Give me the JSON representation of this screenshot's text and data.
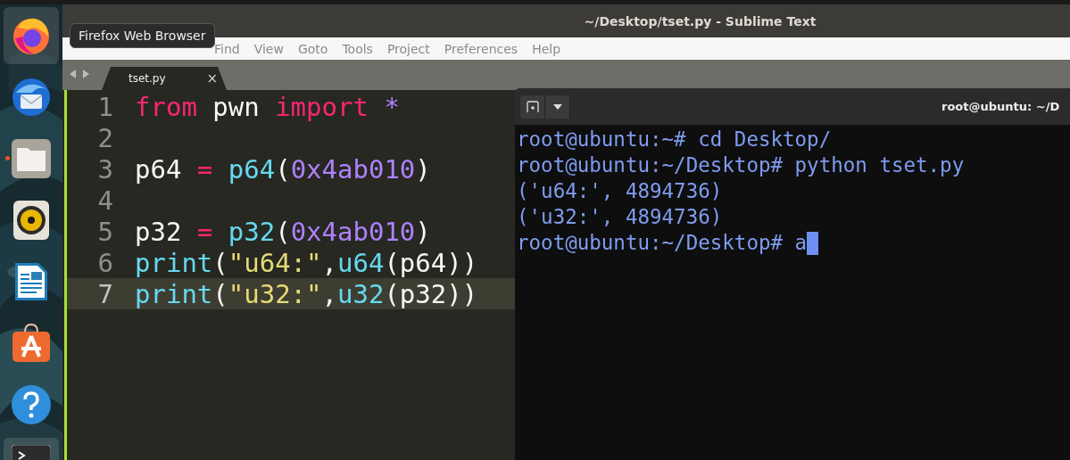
{
  "dock": {
    "items": [
      {
        "kind": "browser",
        "highlighted": true,
        "running": false
      },
      {
        "kind": "mail",
        "highlighted": false,
        "running": false
      },
      {
        "kind": "files",
        "highlighted": false,
        "running": true
      },
      {
        "kind": "music",
        "highlighted": false,
        "running": false
      },
      {
        "kind": "writer",
        "highlighted": false,
        "running": false
      },
      {
        "kind": "store",
        "highlighted": false,
        "running": false
      },
      {
        "kind": "help",
        "highlighted": false,
        "running": false
      },
      {
        "kind": "terminal",
        "highlighted": true,
        "running": true
      }
    ]
  },
  "tooltip": "Firefox Web Browser",
  "editor": {
    "title": "~/Desktop/tset.py - Sublime Text",
    "menu": [
      "Find",
      "View",
      "Goto",
      "Tools",
      "Project",
      "Preferences",
      "Help"
    ],
    "tabs": [
      {
        "label": "tset.py",
        "close": "×",
        "selected": true
      }
    ],
    "lines": [
      {
        "number": "1",
        "current": false,
        "tokens": [
          {
            "text": "from",
            "kind": "keyword"
          },
          {
            "text": " pwn ",
            "kind": "plain"
          },
          {
            "text": "import ",
            "kind": "keyword"
          },
          {
            "text": "*",
            "kind": "constant"
          }
        ]
      },
      {
        "number": "2",
        "current": false
      },
      {
        "number": "3",
        "current": false,
        "tokens": [
          {
            "text": "p64 ",
            "kind": "plain"
          },
          {
            "text": "= ",
            "kind": "keyword"
          },
          {
            "text": "p64",
            "kind": "function"
          },
          {
            "text": "(",
            "kind": "plain"
          },
          {
            "text": "0x4ab010",
            "kind": "constant"
          },
          {
            "text": ")",
            "kind": "plain"
          }
        ]
      },
      {
        "number": "4",
        "current": false
      },
      {
        "number": "5",
        "current": false,
        "tokens": [
          {
            "text": "p32 ",
            "kind": "plain"
          },
          {
            "text": "= ",
            "kind": "keyword"
          },
          {
            "text": "p32",
            "kind": "function"
          },
          {
            "text": "(",
            "kind": "plain"
          },
          {
            "text": "0x4ab010",
            "kind": "constant"
          },
          {
            "text": ")",
            "kind": "plain"
          }
        ]
      },
      {
        "number": "6",
        "current": false,
        "tokens": [
          {
            "text": "print",
            "kind": "function"
          },
          {
            "text": "(",
            "kind": "plain"
          },
          {
            "text": "\"u64:\"",
            "kind": "string"
          },
          {
            "text": ",",
            "kind": "plain"
          },
          {
            "text": "u64",
            "kind": "function"
          },
          {
            "text": "(p64))",
            "kind": "plain"
          }
        ]
      },
      {
        "number": "7",
        "current": true,
        "tokens": [
          {
            "text": "print",
            "kind": "function"
          },
          {
            "text": "(",
            "kind": "plain"
          },
          {
            "text": "\"u32:\"",
            "kind": "string"
          },
          {
            "text": ",",
            "kind": "plain"
          },
          {
            "text": "u32",
            "kind": "function"
          },
          {
            "text": "(p32))",
            "kind": "plain"
          }
        ]
      }
    ]
  },
  "terminal": {
    "title": "root@ubuntu: ~/D",
    "cursor_visible": true,
    "lines": [
      "root@ubuntu:~# cd Desktop/",
      "root@ubuntu:~/Desktop# python tset.py",
      "('u64:', 4894736)",
      "('u32:', 4894736)",
      "root@ubuntu:~/Desktop# a"
    ]
  }
}
